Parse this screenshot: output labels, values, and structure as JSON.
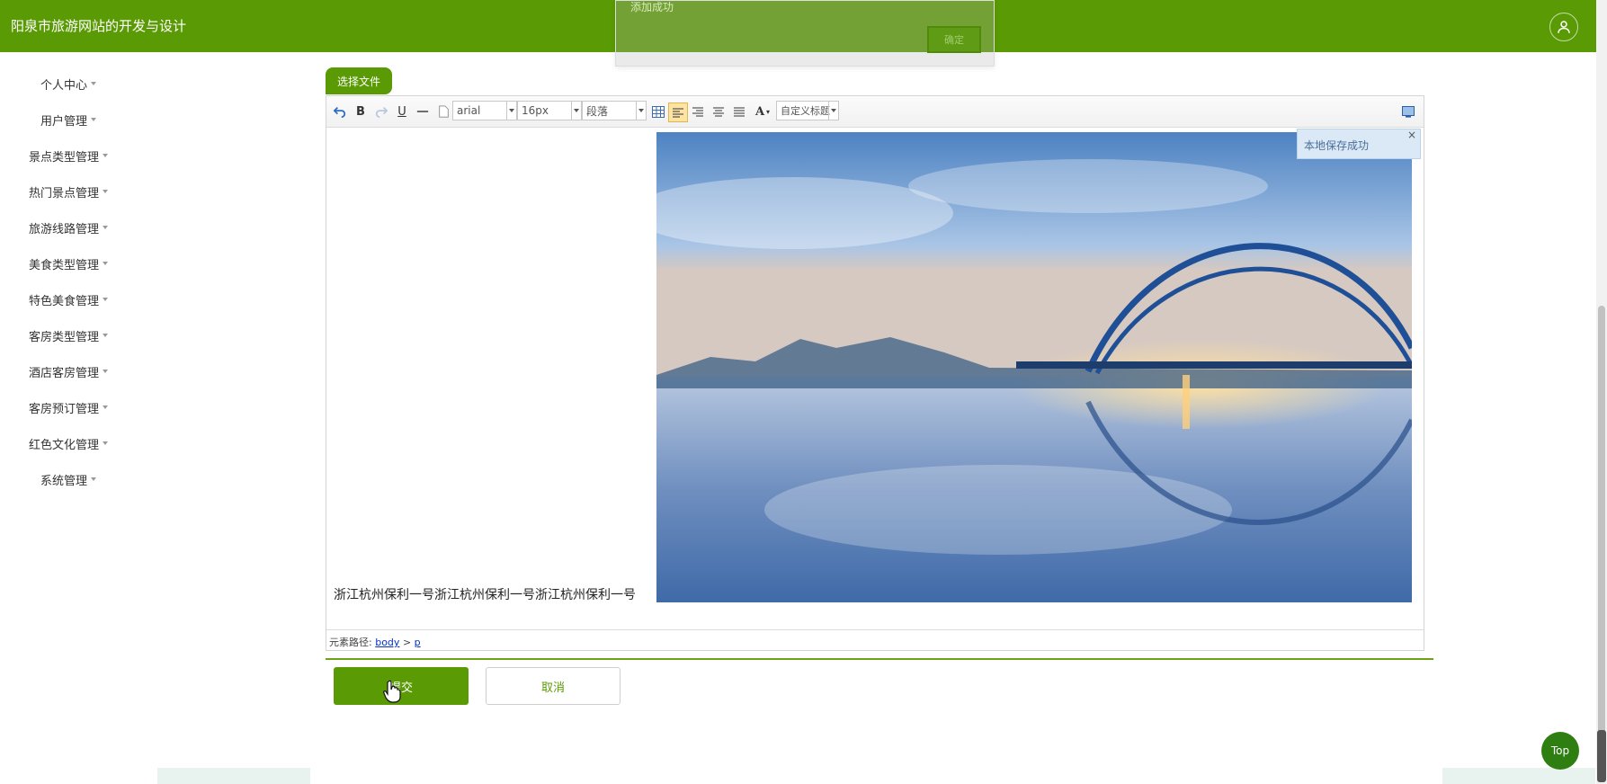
{
  "header": {
    "title": "阳泉市旅游网站的开发与设计",
    "user_icon": "user-icon"
  },
  "sidebar": {
    "items": [
      {
        "label": "个人中心"
      },
      {
        "label": "用户管理"
      },
      {
        "label": "景点类型管理"
      },
      {
        "label": "热门景点管理"
      },
      {
        "label": "旅游线路管理"
      },
      {
        "label": "美食类型管理"
      },
      {
        "label": "特色美食管理"
      },
      {
        "label": "客房类型管理"
      },
      {
        "label": "酒店客房管理"
      },
      {
        "label": "客房预订管理"
      },
      {
        "label": "红色文化管理"
      },
      {
        "label": "系统管理"
      }
    ]
  },
  "toast": {
    "message": "添加成功",
    "ok_label": "确定"
  },
  "upload": {
    "choose_file_label": "选择文件"
  },
  "editor": {
    "toolbar": {
      "bold": "B",
      "underline": "U",
      "font_family": "arial",
      "font_size": "16px",
      "paragraph": "段落",
      "font_color": "A",
      "custom_title": "自定义标题"
    },
    "content_text": "浙江杭州保利一号浙江杭州保利一号浙江杭州保利一号",
    "save_note": "本地保存成功",
    "save_note_close": "×",
    "path_label": "元素路径:",
    "path_body": "body",
    "path_sep": ">",
    "path_p": "p"
  },
  "actions": {
    "submit_label": "提交",
    "cancel_label": "取消"
  },
  "top_button_label": "Top",
  "colors": {
    "brand": "#5a9a05",
    "top_button": "#2f7e12"
  }
}
